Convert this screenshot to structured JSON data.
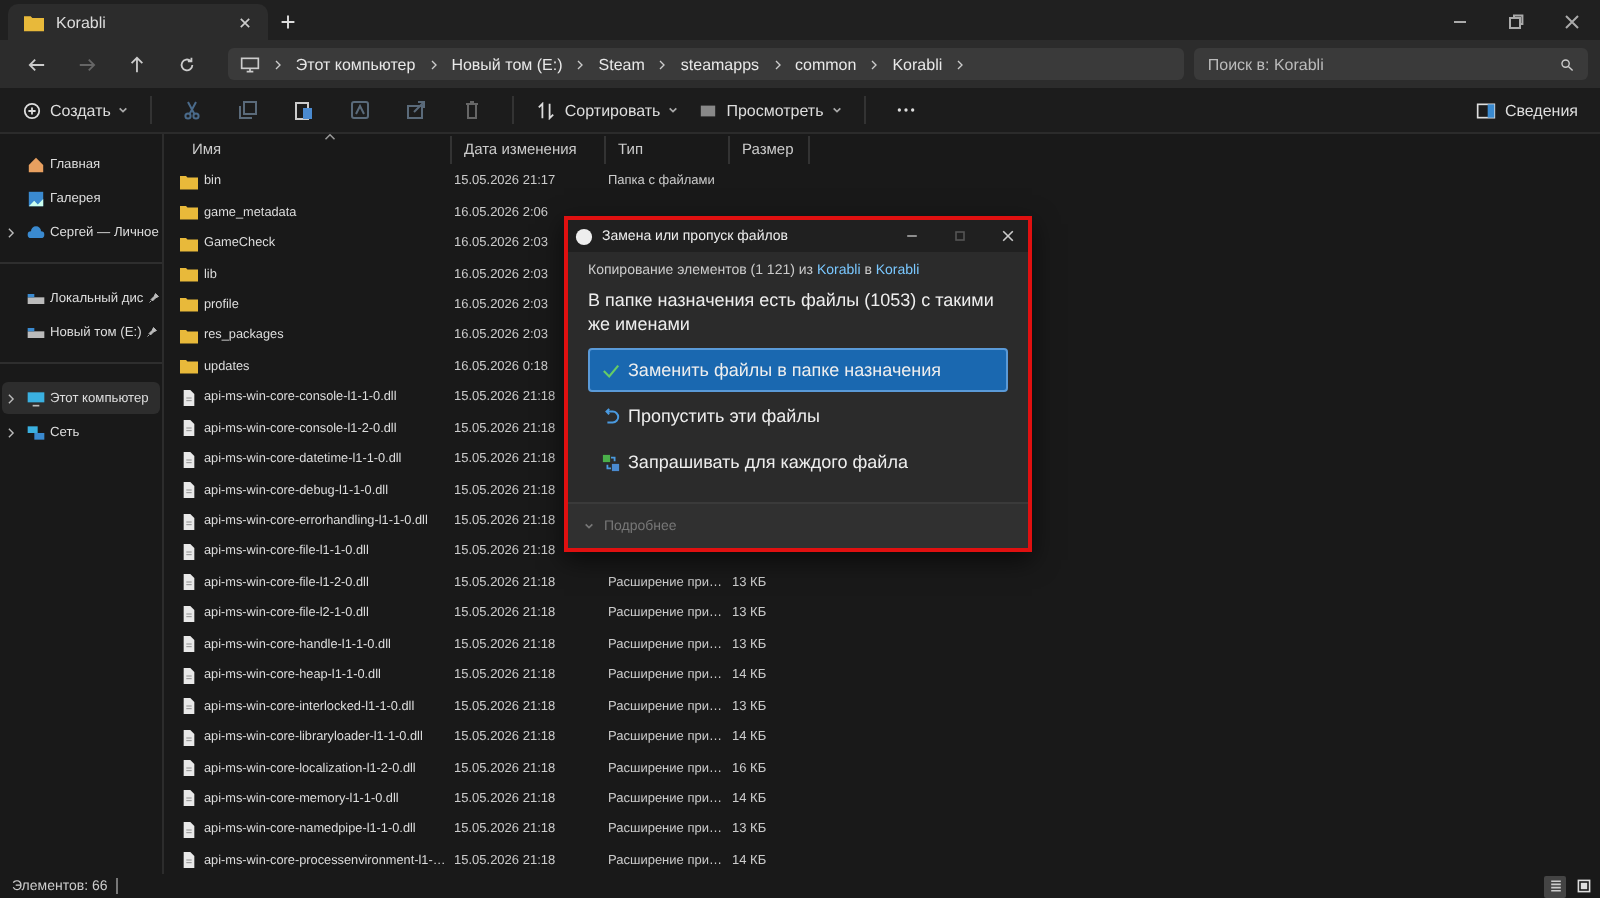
{
  "tabs": [
    {
      "title": "Korabli",
      "selected": true
    }
  ],
  "address_bar": {
    "crumbs": [
      "Этот компьютер",
      "Новый том (E:)",
      "Steam",
      "steamapps",
      "common",
      "Korabli"
    ]
  },
  "search": {
    "placeholder": "Поиск в: Korabli"
  },
  "toolbar": {
    "new_label": "Создать",
    "sort_label": "Сортировать",
    "view_label": "Просмотреть",
    "details_label": "Сведения"
  },
  "sidebar": {
    "groups": [
      [
        {
          "label": "Главная",
          "kind": "home",
          "expandable": false,
          "pinned": false,
          "selected": false
        },
        {
          "label": "Галерея",
          "kind": "gallery",
          "expandable": false,
          "pinned": false,
          "selected": false
        },
        {
          "label": "Сергей — Личное",
          "kind": "cloud",
          "expandable": true,
          "pinned": false,
          "selected": false
        }
      ],
      [
        {
          "label": "Локальный дис",
          "kind": "drive",
          "expandable": false,
          "pinned": true,
          "selected": false
        },
        {
          "label": "Новый том (E:)",
          "kind": "drive",
          "expandable": false,
          "pinned": true,
          "selected": false
        }
      ],
      [
        {
          "label": "Этот компьютер",
          "kind": "pc",
          "expandable": true,
          "pinned": false,
          "selected": true
        },
        {
          "label": "Сеть",
          "kind": "network",
          "expandable": true,
          "pinned": false,
          "selected": false
        }
      ]
    ]
  },
  "table": {
    "columns": [
      "Имя",
      "Дата изменения",
      "Тип",
      "Размер"
    ],
    "rows": [
      {
        "name": "bin",
        "kind": "folder",
        "date": "15.05.2026 21:17",
        "type": "Папка с файлами"
      },
      {
        "name": "game_metadata",
        "kind": "folder",
        "date": "16.05.2026 2:06"
      },
      {
        "name": "GameCheck",
        "kind": "folder",
        "date": "16.05.2026 2:03"
      },
      {
        "name": "lib",
        "kind": "folder",
        "date": "16.05.2026 2:03"
      },
      {
        "name": "profile",
        "kind": "folder",
        "date": "16.05.2026 2:03"
      },
      {
        "name": "res_packages",
        "kind": "folder",
        "date": "16.05.2026 2:03"
      },
      {
        "name": "updates",
        "kind": "folder",
        "date": "16.05.2026 0:18"
      },
      {
        "name": "api-ms-win-core-console-l1-1-0.dll",
        "kind": "file",
        "date": "15.05.2026 21:18"
      },
      {
        "name": "api-ms-win-core-console-l1-2-0.dll",
        "kind": "file",
        "date": "15.05.2026 21:18"
      },
      {
        "name": "api-ms-win-core-datetime-l1-1-0.dll",
        "kind": "file",
        "date": "15.05.2026 21:18"
      },
      {
        "name": "api-ms-win-core-debug-l1-1-0.dll",
        "kind": "file",
        "date": "15.05.2026 21:18"
      },
      {
        "name": "api-ms-win-core-errorhandling-l1-1-0.dll",
        "kind": "file",
        "date": "15.05.2026 21:18"
      },
      {
        "name": "api-ms-win-core-file-l1-1-0.dll",
        "kind": "file",
        "date": "15.05.2026 21:18"
      },
      {
        "name": "api-ms-win-core-file-l1-2-0.dll",
        "kind": "file",
        "date": "15.05.2026 21:18",
        "type": "Расширение при…",
        "size": "13 КБ"
      },
      {
        "name": "api-ms-win-core-file-l2-1-0.dll",
        "kind": "file",
        "date": "15.05.2026 21:18",
        "type": "Расширение при…",
        "size": "13 КБ"
      },
      {
        "name": "api-ms-win-core-handle-l1-1-0.dll",
        "kind": "file",
        "date": "15.05.2026 21:18",
        "type": "Расширение при…",
        "size": "13 КБ"
      },
      {
        "name": "api-ms-win-core-heap-l1-1-0.dll",
        "kind": "file",
        "date": "15.05.2026 21:18",
        "type": "Расширение при…",
        "size": "14 КБ"
      },
      {
        "name": "api-ms-win-core-interlocked-l1-1-0.dll",
        "kind": "file",
        "date": "15.05.2026 21:18",
        "type": "Расширение при…",
        "size": "13 КБ"
      },
      {
        "name": "api-ms-win-core-libraryloader-l1-1-0.dll",
        "kind": "file",
        "date": "15.05.2026 21:18",
        "type": "Расширение при…",
        "size": "14 КБ"
      },
      {
        "name": "api-ms-win-core-localization-l1-2-0.dll",
        "kind": "file",
        "date": "15.05.2026 21:18",
        "type": "Расширение при…",
        "size": "16 КБ"
      },
      {
        "name": "api-ms-win-core-memory-l1-1-0.dll",
        "kind": "file",
        "date": "15.05.2026 21:18",
        "type": "Расширение при…",
        "size": "14 КБ"
      },
      {
        "name": "api-ms-win-core-namedpipe-l1-1-0.dll",
        "kind": "file",
        "date": "15.05.2026 21:18",
        "type": "Расширение при…",
        "size": "13 КБ"
      },
      {
        "name": "api-ms-win-core-processenvironment-l1-…",
        "kind": "file",
        "date": "15.05.2026 21:18",
        "type": "Расширение при…",
        "size": "14 КБ"
      }
    ]
  },
  "dialog": {
    "title": "Замена или пропуск файлов",
    "copy_prefix": "Копирование элементов (1 121) из",
    "source": "Korabli",
    "copy_middle": "в",
    "destination": "Korabli",
    "heading": "В папке назначения есть файлы (1053) с такими же именами",
    "options": [
      {
        "kind": "replace",
        "label": "Заменить файлы в папке назначения",
        "selected": true
      },
      {
        "kind": "skip",
        "label": "Пропустить эти файлы",
        "selected": false
      },
      {
        "kind": "ask",
        "label": "Запрашивать для каждого файла",
        "selected": false
      }
    ],
    "details_label": "Подробнее"
  },
  "status_bar": {
    "count": "Элементов: 66"
  },
  "view_modes": [
    {
      "kind": "details",
      "selected": true
    },
    {
      "kind": "tiles",
      "selected": false
    }
  ]
}
